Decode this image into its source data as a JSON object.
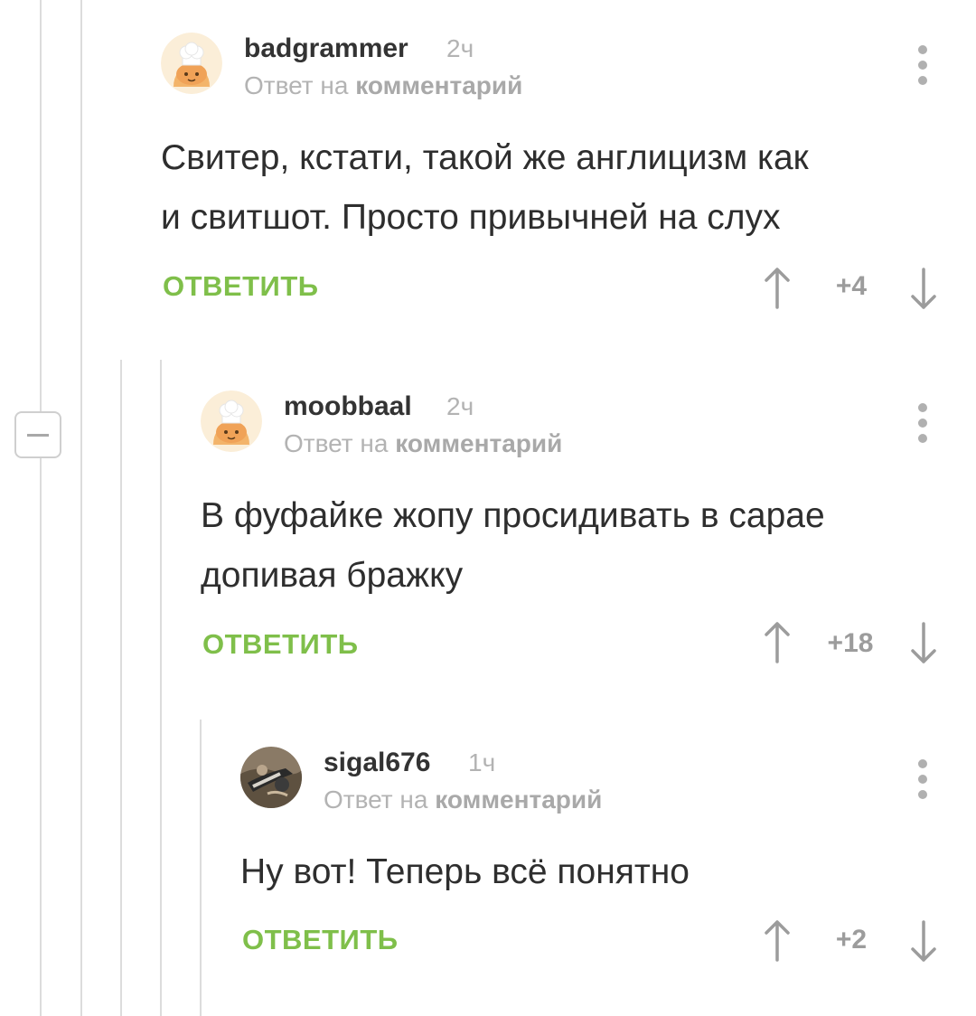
{
  "thread": {
    "collapse_label": "−"
  },
  "comments": [
    {
      "username": "badgrammer",
      "time": "2ч",
      "reply_prefix": "Ответ на",
      "reply_link": "комментарий",
      "body_lines": [
        "Свитер, кстати, такой же англицизм как",
        "и свитшот. Просто привычней на слух"
      ],
      "reply_label": "ОТВЕТИТЬ",
      "score": "+4",
      "avatar_icon": "cook-avatar-icon"
    },
    {
      "username": "moobbaal",
      "time": "2ч",
      "reply_prefix": "Ответ на",
      "reply_link": "комментарий",
      "body_lines": [
        "В фуфайке жопу просидивать в сарае",
        "допивая бражку"
      ],
      "reply_label": "ОТВЕТИТЬ",
      "score": "+18",
      "avatar_icon": "cook-avatar-icon"
    },
    {
      "username": "sigal676",
      "time": "1ч",
      "reply_prefix": "Ответ на",
      "reply_link": "комментарий",
      "body_lines": [
        "Ну вот! Теперь всё понятно"
      ],
      "reply_label": "ОТВЕТИТЬ",
      "score": "+2",
      "avatar_icon": "photo-avatar-icon"
    }
  ],
  "colors": {
    "accent_green": "#7fbf4a",
    "muted_gray": "#b3b3b3",
    "thread_line": "#dcdcdc"
  }
}
